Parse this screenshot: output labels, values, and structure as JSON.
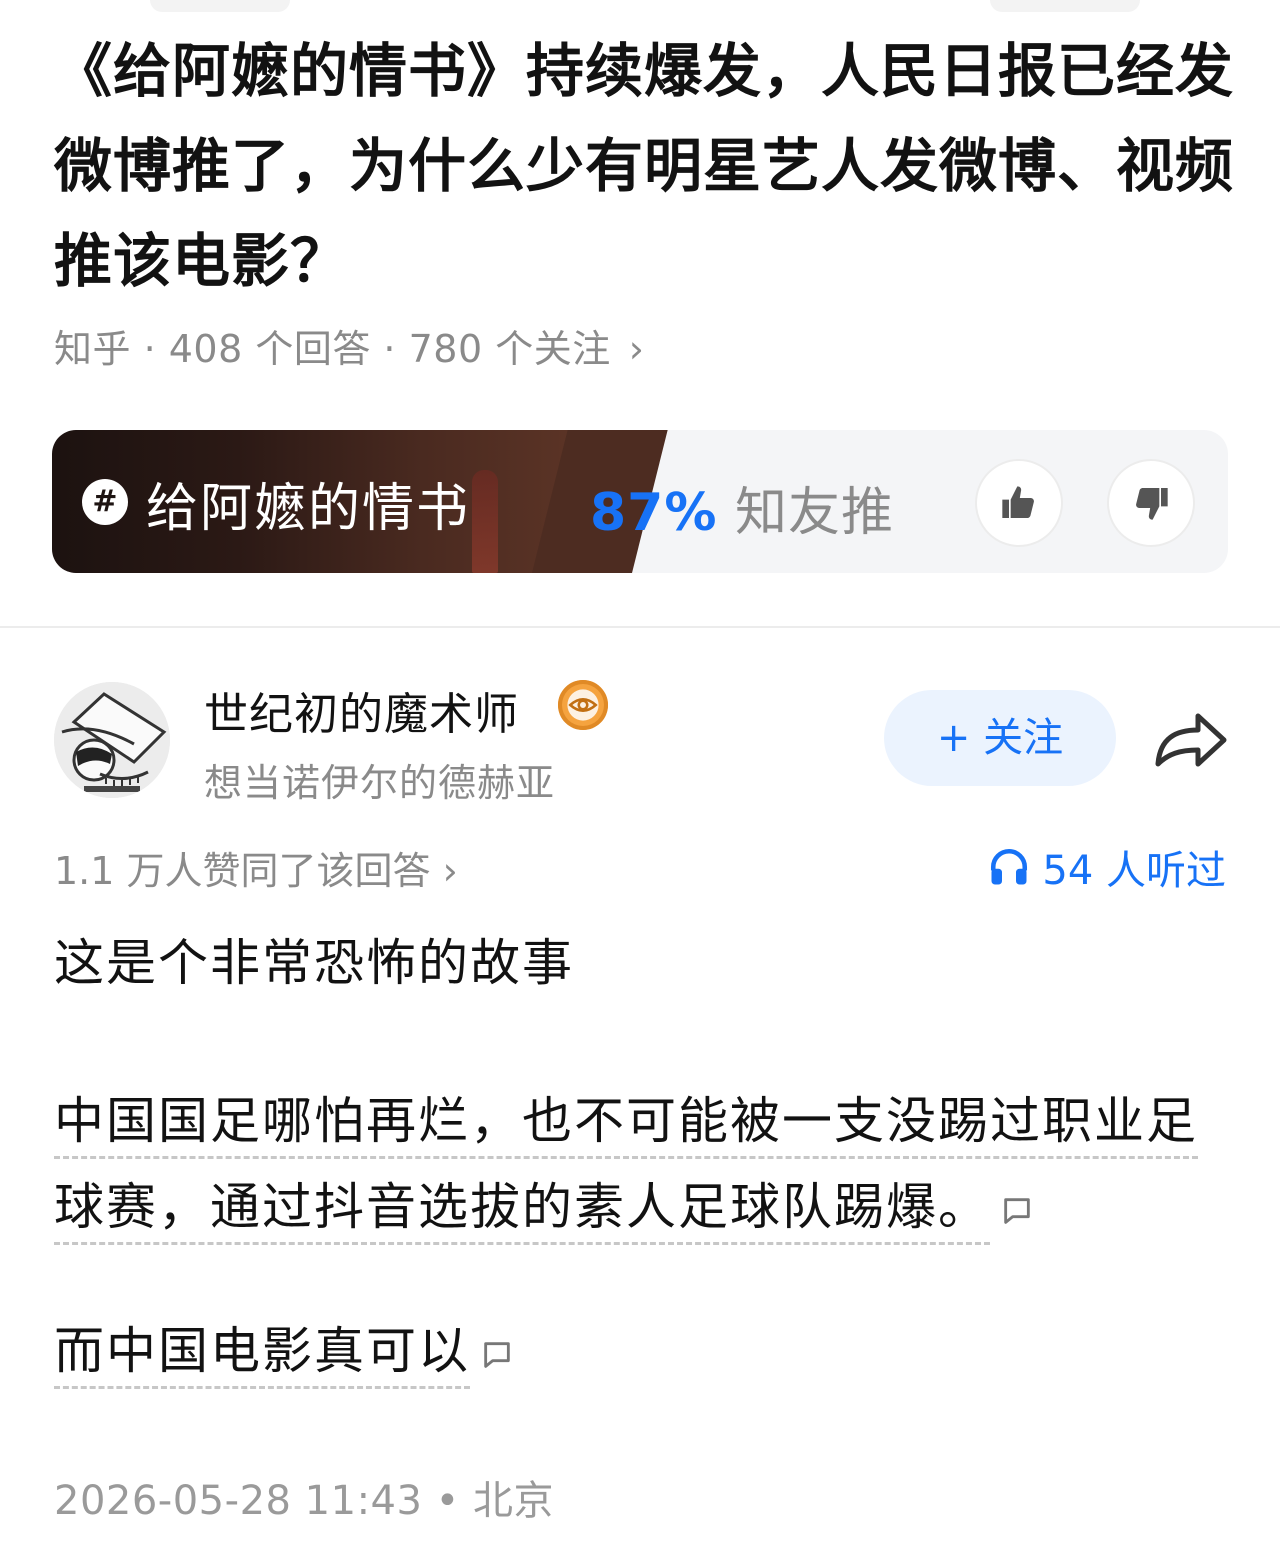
{
  "question": {
    "title": "《给阿嬷的情书》持续爆发，人民日报已经发微博推了，为什么少有明星艺人发微博、视频推该电影？",
    "meta": "知乎 · 408 个回答 · 780 个关注",
    "chevron": "›"
  },
  "movie_card": {
    "topic_icon": "#",
    "name": "给阿嬷的情书",
    "rating_percent": "87%",
    "rating_label": " 知友推",
    "icons": {
      "up": "thumbs-up-icon",
      "down": "thumbs-down-icon"
    }
  },
  "author": {
    "name": "世纪初的魔术师",
    "bio": "想当诺伊尔的德赫亚",
    "follow_label": "+ 关注",
    "badge": "eye-badge-icon"
  },
  "stats": {
    "upvotes": "1.1 万人赞同了该回答",
    "chevron": "›",
    "listened": "54 人听过"
  },
  "answer": {
    "p1": "这是个非常恐怖的故事",
    "p2": "中国国足哪怕再烂，也不可能被一支没踢过职业足球赛，通过抖音选拔的素人足球队踢爆。",
    "p3": "而中国电影真可以"
  },
  "footer": {
    "timestamp": "2026-05-28 11:43",
    "separator": " • ",
    "location": "北京"
  },
  "colors": {
    "accent": "#1772f6",
    "muted": "#8a8a8a",
    "text": "#121212",
    "follow_bg": "#ebf3fe"
  }
}
